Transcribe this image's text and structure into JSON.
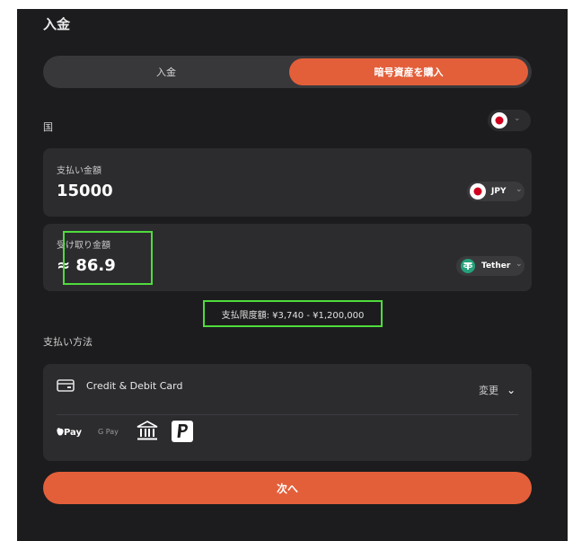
{
  "header": {
    "title": "入金"
  },
  "tabs": [
    {
      "label": "入金",
      "active": false
    },
    {
      "label": "暗号資産を購入",
      "active": true
    }
  ],
  "country": {
    "label": "国",
    "flag": "japan-flag-icon"
  },
  "pay_amount": {
    "label": "支払い金額",
    "value": "15000",
    "currency": "JPY"
  },
  "receive_amount": {
    "label": "受け取り金額",
    "value": "≈ 86.9",
    "currency": "Tether"
  },
  "limit": {
    "text": "支払限度額: ¥3,740 - ¥1,200,000"
  },
  "payment_method": {
    "label": "支払い方法",
    "method": "Credit & Debit Card",
    "change_label": "変更",
    "options": [
      "Apple Pay",
      "Google Pay",
      "Bank",
      "PayPal"
    ],
    "apple_pay_text": "Pay",
    "google_pay_text": "G Pay"
  },
  "next_button": {
    "label": "次へ"
  },
  "colors": {
    "accent": "#e35f3a",
    "highlight": "#4fdc3c",
    "panel": "#1c1c1e",
    "card": "#2c2c2f",
    "tether": "#26a17b"
  }
}
